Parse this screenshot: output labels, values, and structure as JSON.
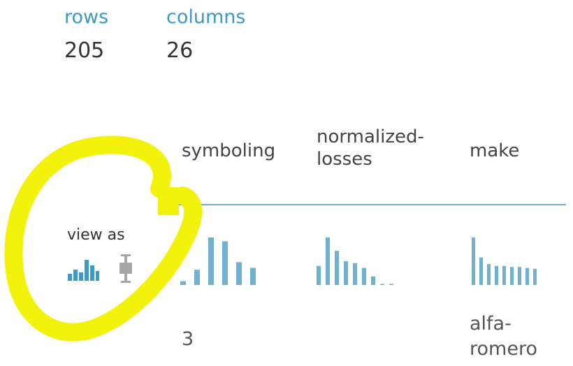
{
  "summary": {
    "rows_label": "rows",
    "rows_value": "205",
    "columns_label": "columns",
    "columns_value": "26"
  },
  "view_as": {
    "label": "view as",
    "histogram_icon": "histogram-icon",
    "boxplot_icon": "boxplot-icon"
  },
  "columns": [
    {
      "header": "symboling",
      "histogram": [
        0.08,
        0.32,
        1.0,
        0.92,
        0.48,
        0.36
      ],
      "first_value": "3"
    },
    {
      "header": "normalized-losses",
      "header_lines": [
        "normalized-",
        "losses"
      ],
      "histogram": [
        0.4,
        1.0,
        0.72,
        0.5,
        0.46,
        0.36,
        0.18,
        0.02,
        0.02
      ],
      "first_value": ""
    },
    {
      "header": "make",
      "histogram": [
        1.0,
        0.58,
        0.44,
        0.4,
        0.4,
        0.38,
        0.38,
        0.36,
        0.34
      ],
      "first_value": "alfa-romero",
      "first_value_lines": [
        "alfa-",
        "romero"
      ]
    }
  ],
  "colors": {
    "accent": "#3a9bc4",
    "bar": "#6fb1cf",
    "highlight": "#f2f20a",
    "inactive_icon": "#a7a7a7"
  }
}
